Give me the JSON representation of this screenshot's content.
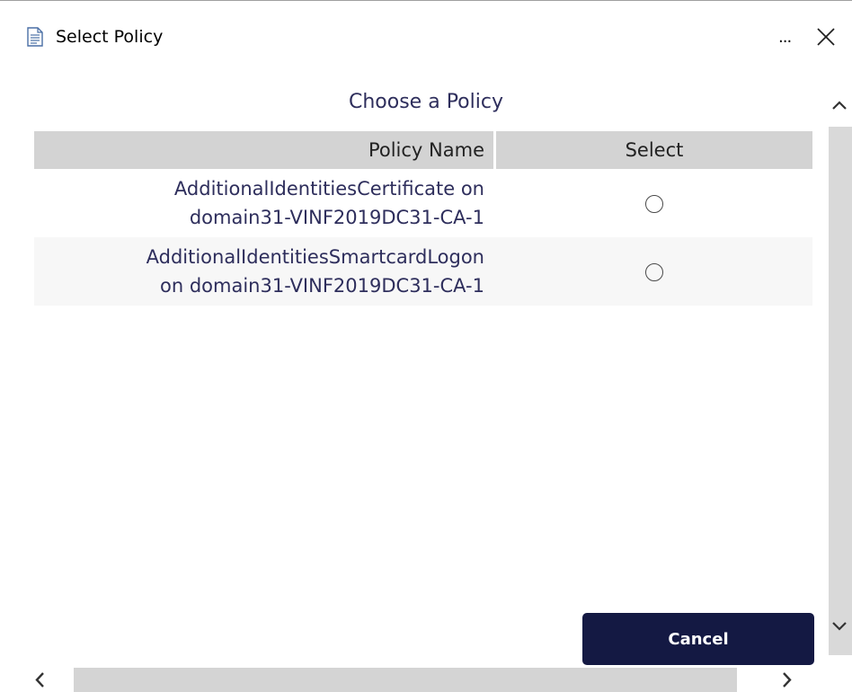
{
  "window": {
    "title": "Select Policy",
    "more_label": "...",
    "icon": "document-icon",
    "close_icon": "close-icon"
  },
  "main": {
    "heading": "Choose a Policy",
    "table": {
      "columns": [
        "Policy Name",
        "Select"
      ],
      "rows": [
        {
          "name_line1": "AdditionalIdentitiesCertificate on",
          "name_line2": "domain31-VINF2019DC31-CA-1",
          "selected": false
        },
        {
          "name_line1": "AdditionalIdentitiesSmartcardLogon",
          "name_line2": "on domain31-VINF2019DC31-CA-1",
          "selected": false
        }
      ]
    },
    "cancel_label": "Cancel"
  },
  "scrollbars": {
    "vertical": {
      "up_icon": "chevron-up-icon",
      "down_icon": "chevron-down-icon"
    },
    "horizontal": {
      "left_icon": "chevron-left-icon",
      "right_icon": "chevron-right-icon"
    }
  },
  "colors": {
    "header_bg": "#d3d3d3",
    "text_accent": "#2e2e5c",
    "button_bg": "#141943",
    "alt_row_bg": "#f7f7f7"
  }
}
